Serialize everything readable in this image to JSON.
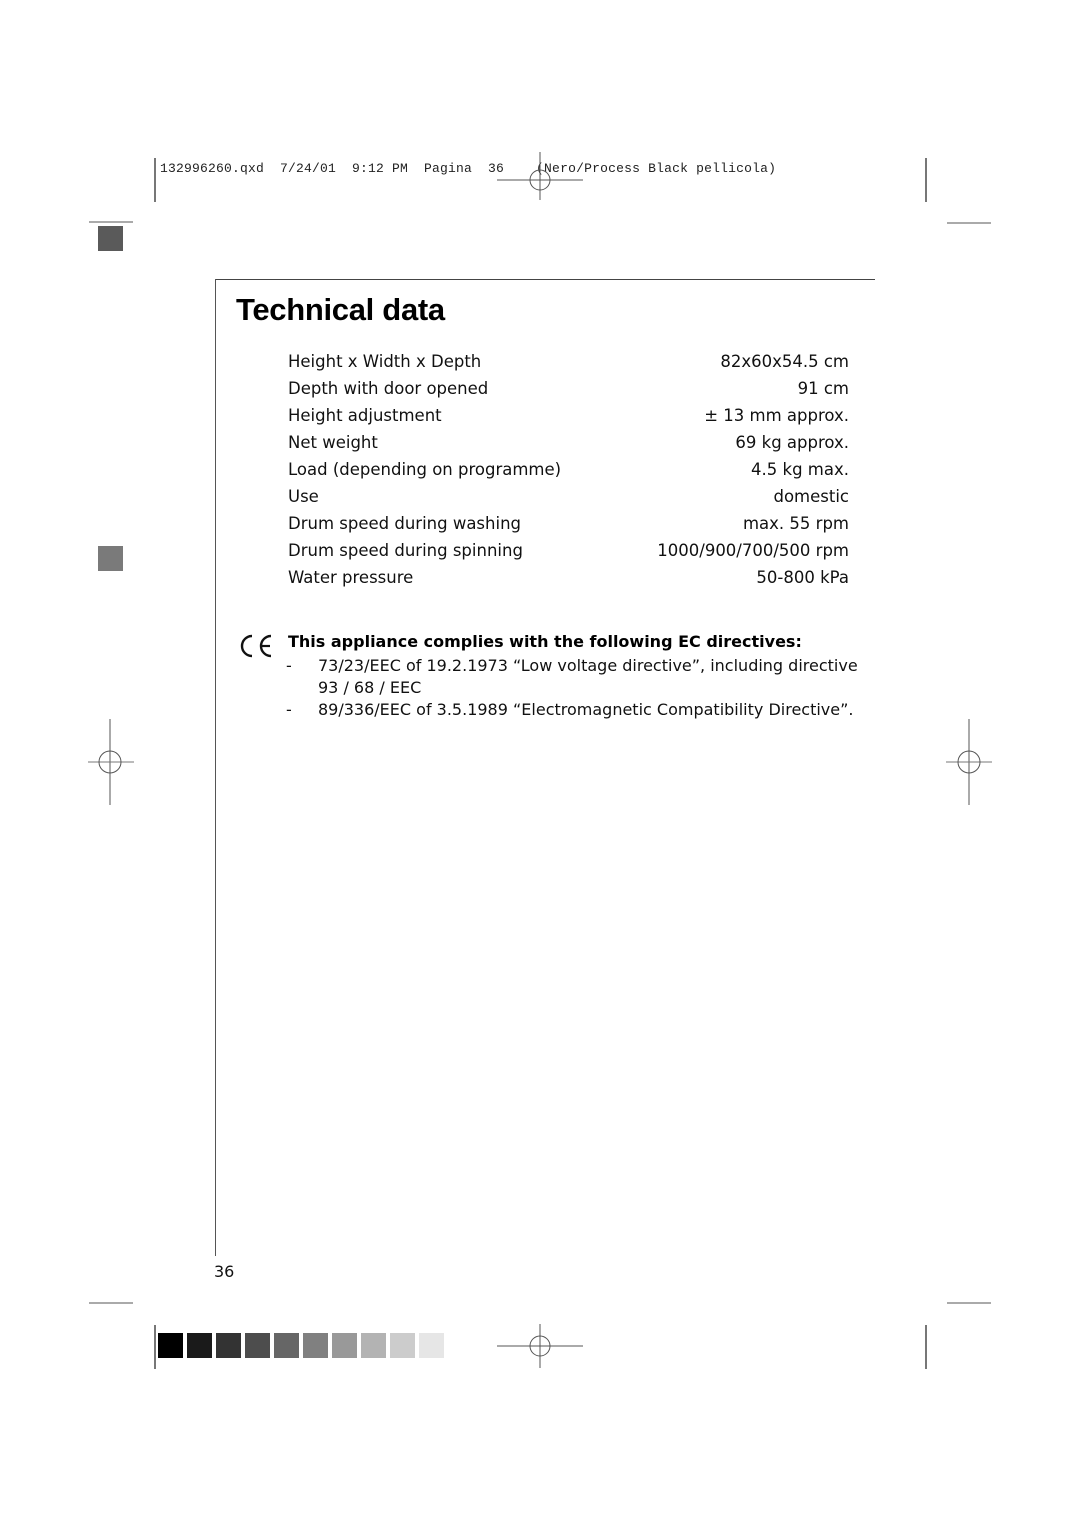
{
  "print_slug": {
    "text": "132996260.qxd  7/24/01  9:12 PM  Pagina  36    (Nero/Process Black pellicola)"
  },
  "page": {
    "title": "Technical data",
    "page_number": "36"
  },
  "specs": [
    {
      "label": "Height x Width x Depth",
      "value": "82x60x54.5 cm"
    },
    {
      "label": "Depth with door opened",
      "value": "91 cm"
    },
    {
      "label": "Height adjustment",
      "value": "± 13 mm approx."
    },
    {
      "label": "Net weight",
      "value": "69 kg approx."
    },
    {
      "label": "Load (depending on programme)",
      "value": "4.5 kg max."
    },
    {
      "label": "Use",
      "value": "domestic"
    },
    {
      "label": "Drum speed during washing",
      "value": "max. 55 rpm"
    },
    {
      "label": "Drum speed during spinning",
      "value": "1000/900/700/500 rpm"
    },
    {
      "label": "Water pressure",
      "value": "50-800 kPa"
    }
  ],
  "compliance": {
    "mark": "CE",
    "heading": "This appliance complies with the following EC directives:",
    "directives": [
      {
        "bullet": "-",
        "line1": "73/23/EEC of 19.2.1973 “Low voltage directive”, including directive",
        "line2": "93 / 68 / EEC"
      },
      {
        "bullet": "-",
        "line1": "89/336/EEC of 3.5.1989 “Electromagnetic Compatibility Directive”."
      }
    ]
  },
  "color_bar": {
    "swatches": [
      "#000000",
      "#1a1a1a",
      "#333333",
      "#4d4d4d",
      "#666666",
      "#808080",
      "#999999",
      "#b3b3b3",
      "#cccccc",
      "#e6e6e6"
    ]
  },
  "side_markers": {
    "upper": "#5a5a5a",
    "lower": "#7a7a7a"
  }
}
